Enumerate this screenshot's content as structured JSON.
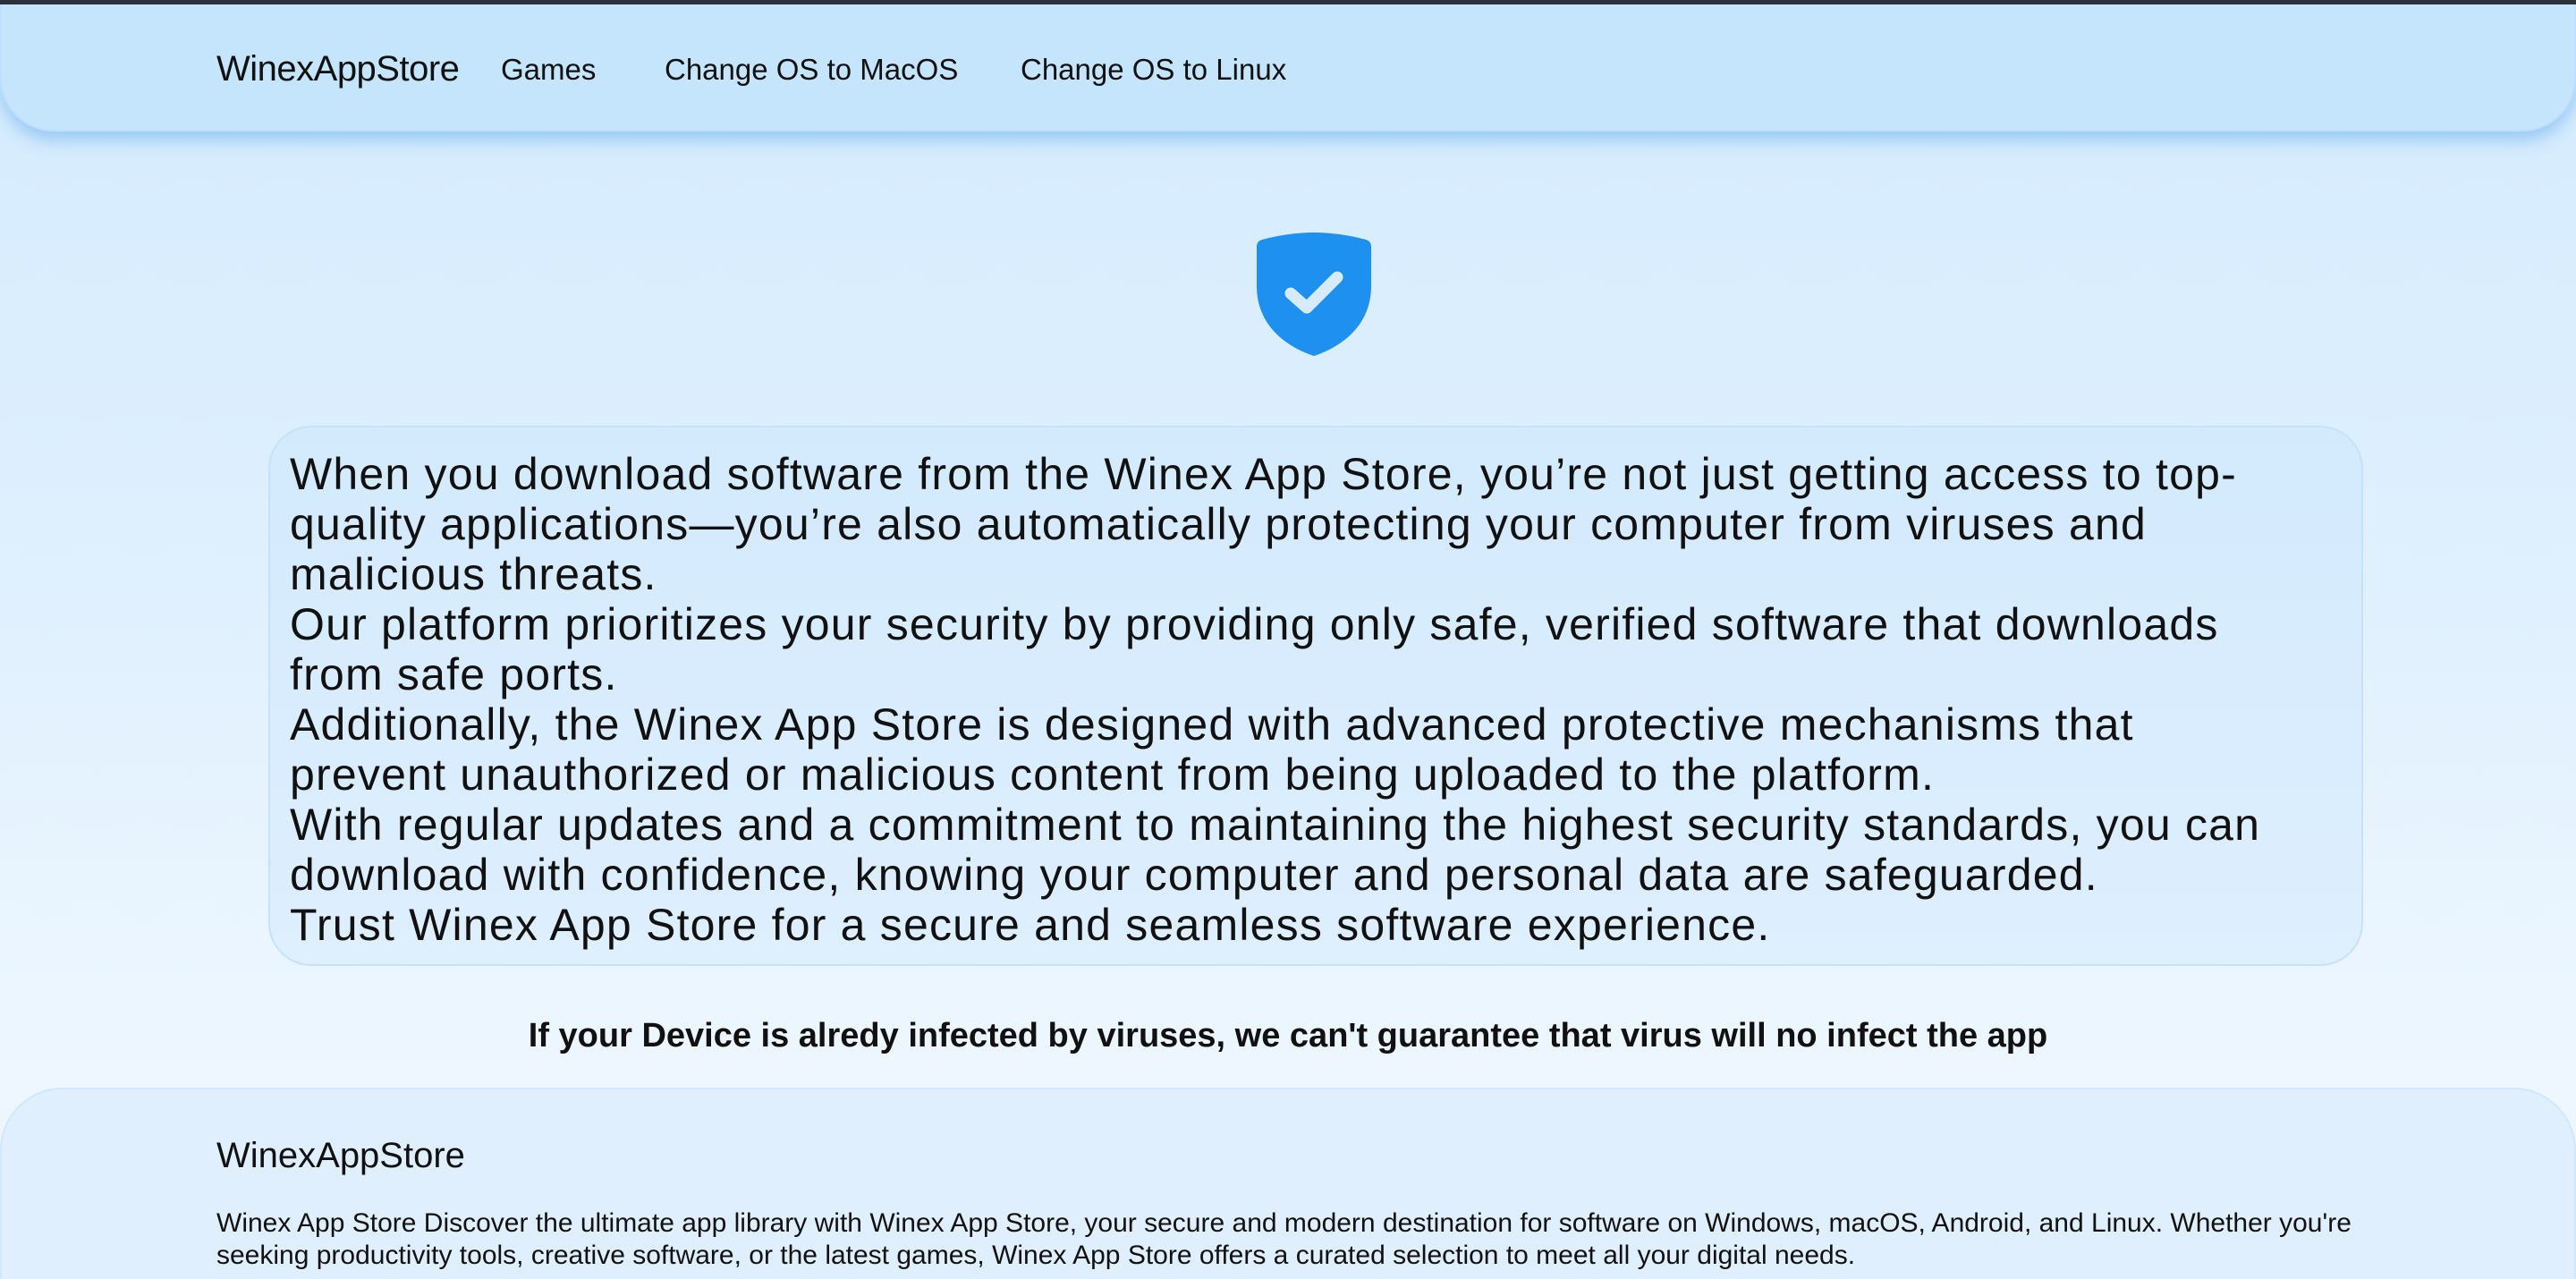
{
  "navbar": {
    "brand": "WinexAppStore",
    "links": [
      "Games",
      "Change OS to MacOS",
      "Change OS to Linux"
    ]
  },
  "hero": {
    "icon": "shield-check-icon",
    "accent_color": "#1e90f0"
  },
  "info": {
    "paragraphs": [
      "When you download software from the Winex App Store, you’re not just getting access to top-quality applications—you’re also automatically protecting your computer from viruses and malicious threats.",
      "Our platform prioritizes your security by providing only safe, verified software that downloads from safe ports.",
      "Additionally, the Winex App Store is designed with advanced protective mechanisms that prevent unauthorized or malicious content from being uploaded to the platform.",
      "With regular updates and a commitment to maintaining the highest security standards, you can download with confidence, knowing your computer and personal data are safeguarded.",
      "Trust Winex App Store for a secure and seamless software experience."
    ],
    "lines": [
      [
        "When you download software from the Winex App Store, you’re not just getting access to top-",
        "quality applications—you’re also automatically protecting your computer from viruses and",
        "malicious threats."
      ],
      [
        "Our platform prioritizes your security by providing only safe, verified software that downloads",
        "from safe ports."
      ],
      [
        "Additionally, the Winex App Store is designed with advanced protective mechanisms that",
        "prevent unauthorized or malicious content from being uploaded to the platform."
      ],
      [
        "With regular updates and a commitment to maintaining the highest security standards, you can",
        "download with confidence, knowing your computer and personal data are safeguarded."
      ],
      [
        "Trust Winex App Store for a secure and seamless software experience."
      ]
    ]
  },
  "warning": "If your Device is alredy infected by viruses, we can't guarantee that virus will no infect the app",
  "footer": {
    "brand": "WinexAppStore",
    "description": "Winex App Store Discover the ultimate app library with Winex App Store, your secure and modern destination for software on Windows, macOS, Android, and Linux. Whether you're seeking productivity tools, creative software, or the latest games, Winex App Store offers a curated selection to meet all your digital needs."
  }
}
